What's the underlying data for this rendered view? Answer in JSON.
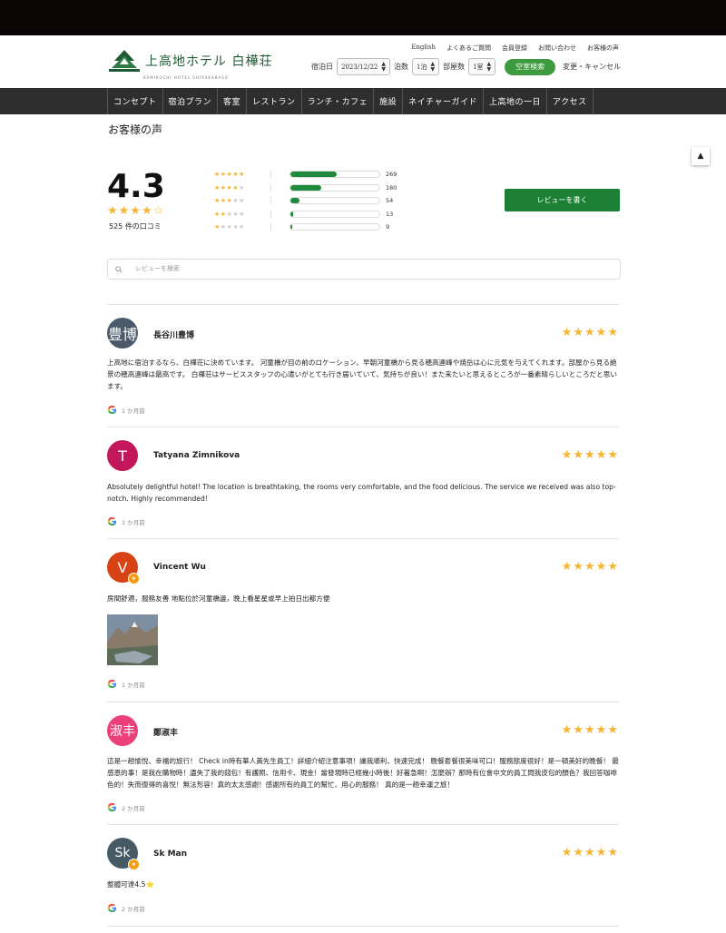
{
  "header": {
    "logo_text": "上高地ホテル 白樺荘",
    "logo_sub": "KAMIKOCHI HOTEL SHIRAKABASO",
    "top_links": [
      "English",
      "よくあるご質問",
      "会員登録",
      "お問い合わせ",
      "お客様の声"
    ],
    "booking": {
      "date_label": "宿泊日",
      "date_value": "2023/12/22",
      "nights_label": "泊数",
      "nights_value": "1泊",
      "rooms_label": "部屋数",
      "rooms_value": "1室",
      "vacancy_button": "空室検索",
      "change_link": "変更・キャンセル"
    }
  },
  "nav": [
    "コンセプト",
    "宿泊プラン",
    "客室",
    "レストラン",
    "ランチ・カフェ",
    "施設",
    "ネイチャーガイド",
    "上高地の一日",
    "アクセス"
  ],
  "page_title": "お客様の声",
  "summary": {
    "average": "4.3",
    "average_stars": "★★★★☆",
    "count_text": "525 件の口コミ",
    "distribution": [
      {
        "stars": 5,
        "count": "269",
        "fraction": 0.52
      },
      {
        "stars": 4,
        "count": "180",
        "fraction": 0.35
      },
      {
        "stars": 3,
        "count": "54",
        "fraction": 0.1
      },
      {
        "stars": 2,
        "count": "13",
        "fraction": 0.03
      },
      {
        "stars": 1,
        "count": "9",
        "fraction": 0.02
      }
    ],
    "write_button": "レビューを書く"
  },
  "search": {
    "placeholder": "レビューを検索"
  },
  "reviews": [
    {
      "initials": "豊博",
      "name": "長谷川豊博",
      "avatar_color": "#4a5a6a",
      "stars": "★★★★★",
      "text": "上高地に宿泊するなら、白樺荘に決めています。 河童橋が目の前のロケーション、早朝河童橋から見る穂高連峰や焼岳は心に元気を与えてくれます。部屋から見る絶景の穂高連峰は最高です。 白樺荘はサービススタッフの心遣いがとても行き届いていて、気持ちが良い！また来たいと思えるところが一番素晴らしいところだと思います。",
      "time": "1 か月前"
    },
    {
      "initials": "T",
      "name": "Tatyana Zimnikova",
      "avatar_color": "#c2185b",
      "stars": "★★★★★",
      "text": "Absolutely delightful hotel! The location is breathtaking, the rooms very comfortable, and the food delicious. The service we received was also top-notch. Highly recommended!",
      "time": "1 か月前"
    },
    {
      "initials": "V",
      "name": "Vincent Wu",
      "avatar_color": "#d84315",
      "stars": "★★★★★",
      "text": "房間舒適，服務友善 地點位於河童橋邊，晚上看星星或早上拍日出都方便",
      "time": "1 か月前"
    },
    {
      "initials": "淑丰",
      "name": "鄭淑丰",
      "avatar_color": "#ec407a",
      "stars": "★★★★★",
      "text": "這是一趟愉悅、幸福的旅行！ Check in時有華人黃先生員工！詳細介紹注意事項！讓我順利、快速完成！ 晚餐套餐很美味可口！服務態度很好！是一頓美好的晚餐！ 最感恩的事！是我在購物時！遺失了我的錢包！有護照、信用卡、現金！當發現時已經幾小時後！好著急啊！怎麼辦？那時有位會中文的員工問我皮包的顏色？我回答咖啡色的！失而復得的喜悅！無法形容！真的太太感謝！感謝所有的員工的幫忙、用心的服務！ 真的是一趟幸運之旅！",
      "time": "2 か月前"
    },
    {
      "initials": "Sk",
      "name": "Sk Man",
      "avatar_color": "#455a64",
      "stars": "★★★★★",
      "text": "整體可達4.5⭐",
      "time": "2 か月前"
    }
  ],
  "colors": {
    "brand_green": "#1b7f34",
    "star": "#f5b533",
    "nav_bg": "#2e2e2e"
  }
}
